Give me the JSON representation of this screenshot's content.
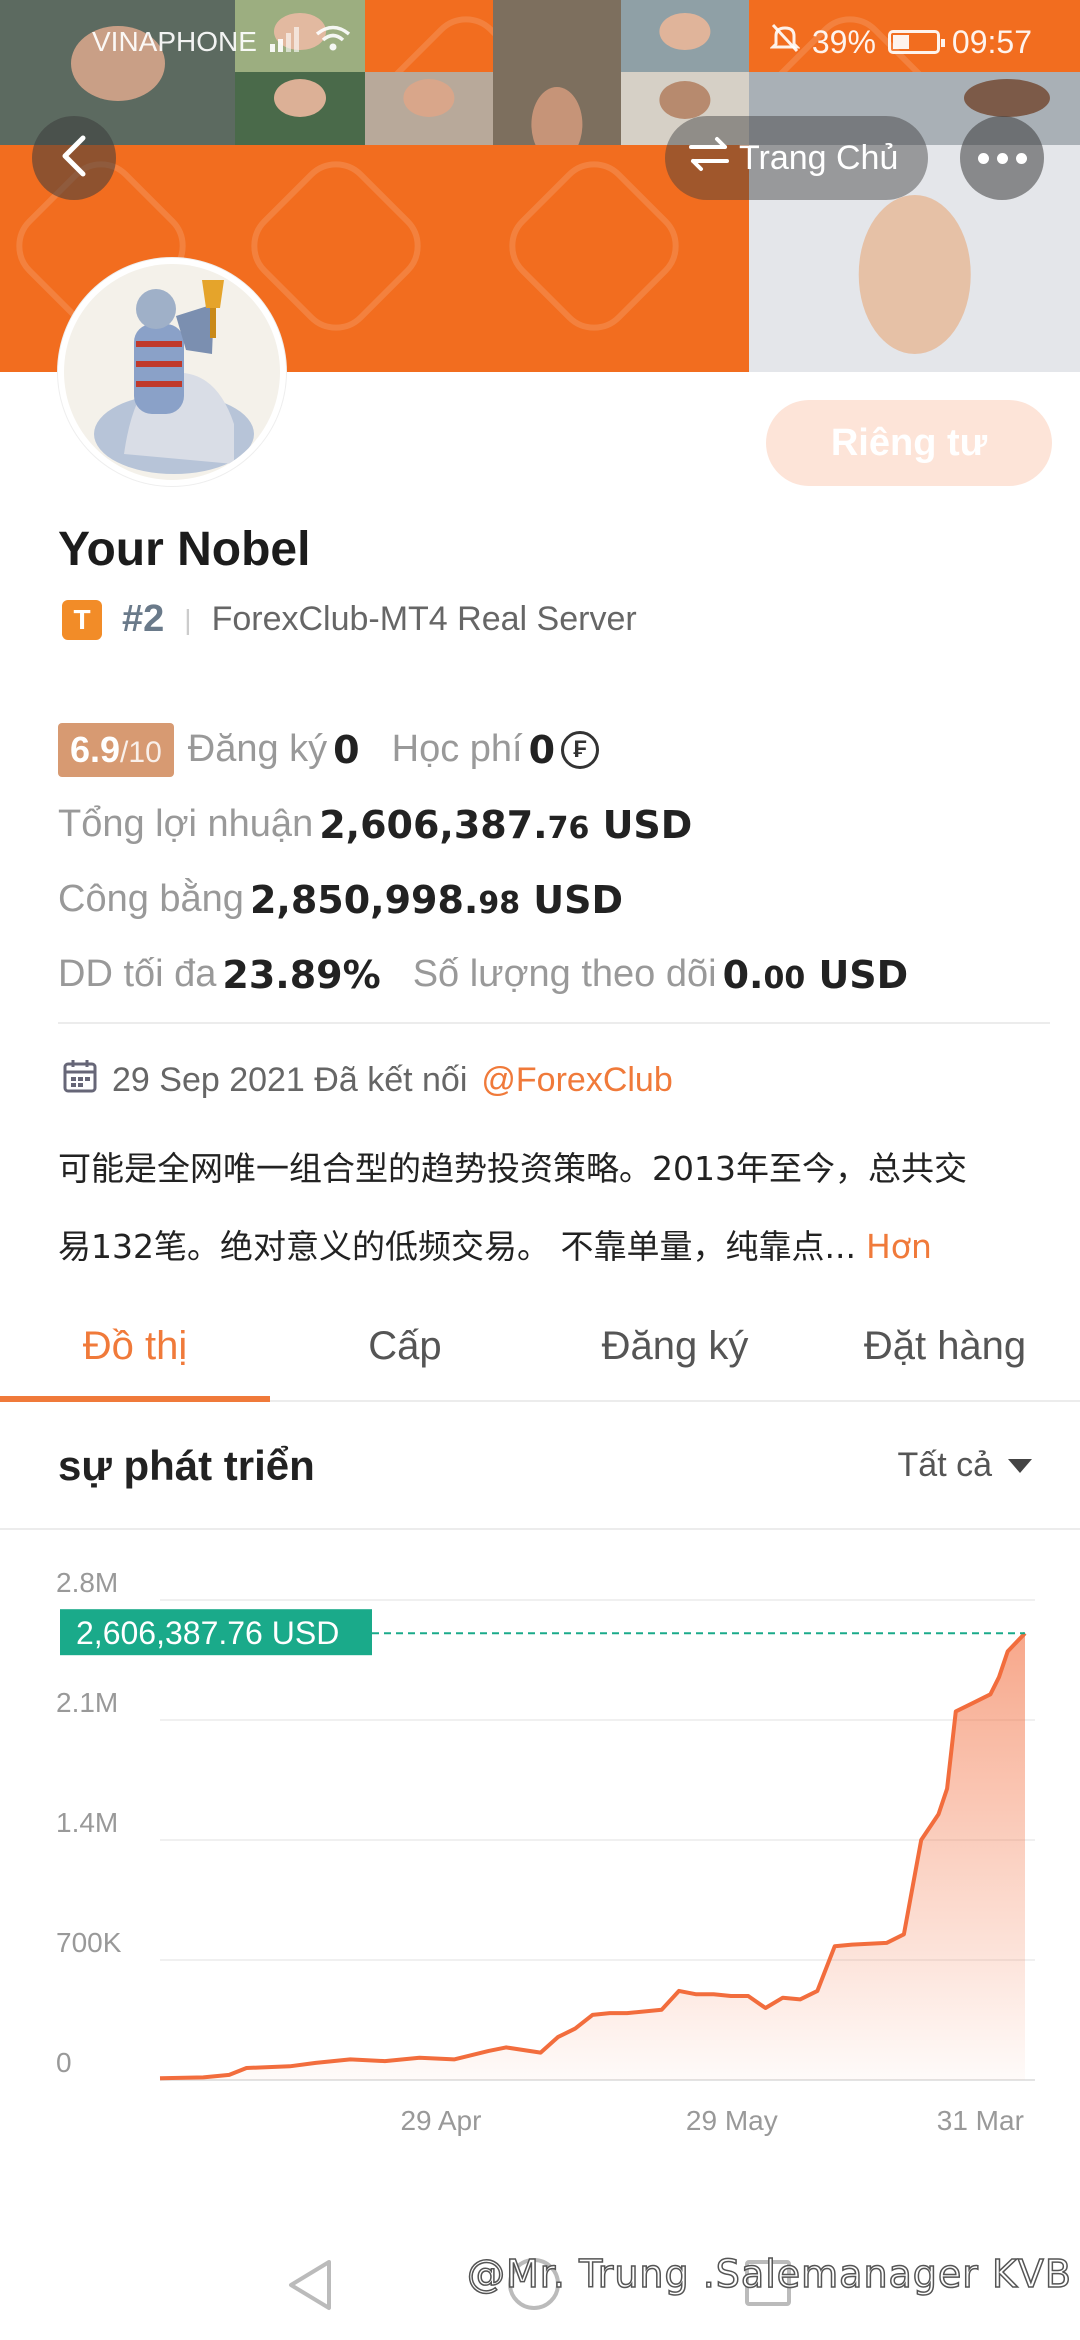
{
  "status_bar": {
    "carrier": "VINAPHONE",
    "battery": "39%",
    "time": "09:57"
  },
  "header": {
    "home_label": "Trang Chủ"
  },
  "profile": {
    "name": "Your Nobel",
    "badge_letter": "T",
    "rank": "#2",
    "server": "ForexClub-MT4 Real Server",
    "private_button": "Riêng tư"
  },
  "stats": {
    "score": "6.9",
    "score_max": "/10",
    "subscribe_label": "Đăng ký",
    "subscribe_value": "0",
    "fee_label": "Học phí",
    "fee_value": "0",
    "total_profit_label": "Tổng lợi nhuận",
    "total_profit_main": "2,606,387.",
    "total_profit_decimals": "76",
    "total_profit_unit": " USD",
    "equity_label": "Công bằng",
    "equity_main": "2,850,998.",
    "equity_decimals": "98",
    "equity_unit": " USD",
    "max_dd_label": "DD tối đa",
    "max_dd_value": "23.89%",
    "follow_label": "Số lượng theo dõi",
    "follow_main": "0.",
    "follow_decimals": "00",
    "follow_unit": " USD"
  },
  "connection": {
    "date": "29 Sep 2021",
    "text": "Đã kết nối",
    "broker": "@ForexClub"
  },
  "description": {
    "line1": "可能是全网唯一组合型的趋势投资策略。2013年至今，总共交",
    "line2": "易132笔。绝对意义的低频交易。 不靠单量，纯靠点...",
    "more": "Hơn"
  },
  "tabs": [
    "Đồ thị",
    "Cấp",
    "Đăng ký",
    "Đặt hàng"
  ],
  "growth": {
    "title": "sự phát triển",
    "filter": "Tất cả"
  },
  "colors": {
    "accent": "#f07a3a",
    "line": "#f26d3d",
    "label_bg": "#1aaa8a"
  },
  "chart_data": {
    "type": "area",
    "current_label": "2,606,387.76 USD",
    "y_ticks": [
      "2.8M",
      "2.1M",
      "1.4M",
      "700K",
      "0"
    ],
    "y_tick_values": [
      2800000,
      2100000,
      1400000,
      700000,
      0
    ],
    "ylim": [
      0,
      2800000
    ],
    "x_ticks": [
      "29 Apr",
      "29 May",
      "31 Mar"
    ],
    "x_tick_positions": [
      0.33,
      0.66,
      0.95
    ],
    "x": [
      0,
      0.05,
      0.08,
      0.1,
      0.15,
      0.18,
      0.22,
      0.26,
      0.3,
      0.34,
      0.38,
      0.4,
      0.44,
      0.46,
      0.48,
      0.5,
      0.52,
      0.54,
      0.58,
      0.6,
      0.62,
      0.64,
      0.66,
      0.68,
      0.7,
      0.72,
      0.74,
      0.76,
      0.78,
      0.8,
      0.84,
      0.86,
      0.88,
      0.9,
      0.91,
      0.92,
      0.94,
      0.96,
      0.97,
      0.98,
      1.0
    ],
    "values": [
      10000,
      15000,
      30000,
      70000,
      80000,
      100000,
      120000,
      110000,
      130000,
      120000,
      170000,
      190000,
      160000,
      250000,
      300000,
      380000,
      390000,
      390000,
      410000,
      520000,
      500000,
      500000,
      490000,
      490000,
      420000,
      480000,
      470000,
      520000,
      780000,
      790000,
      800000,
      850000,
      1400000,
      1550000,
      1700000,
      2150000,
      2200000,
      2250000,
      2350000,
      2500000,
      2606387
    ]
  }
}
